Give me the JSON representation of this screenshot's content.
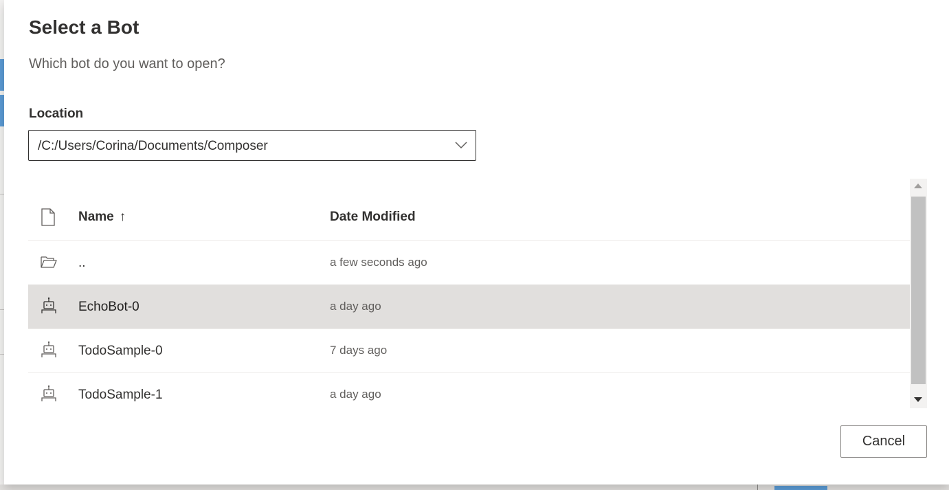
{
  "dialog": {
    "title": "Select a Bot",
    "subtitle": "Which bot do you want to open?",
    "location_label": "Location",
    "location_value": "/C:/Users/Corina/Documents/Composer"
  },
  "table": {
    "columns": {
      "name": "Name",
      "sort_indicator": "↑",
      "date": "Date Modified"
    },
    "rows": [
      {
        "icon": "folder-open-icon",
        "name": "..",
        "date": "a few seconds ago",
        "selected": false
      },
      {
        "icon": "bot-icon",
        "name": "EchoBot-0",
        "date": "a day ago",
        "selected": true
      },
      {
        "icon": "bot-icon",
        "name": "TodoSample-0",
        "date": "7 days ago",
        "selected": false
      },
      {
        "icon": "bot-icon",
        "name": "TodoSample-1",
        "date": "a day ago",
        "selected": false
      }
    ]
  },
  "footer": {
    "cancel_label": "Cancel"
  },
  "colors": {
    "selected_row": "#e1dfdd",
    "text_primary": "#323130",
    "text_secondary": "#605e5c"
  }
}
